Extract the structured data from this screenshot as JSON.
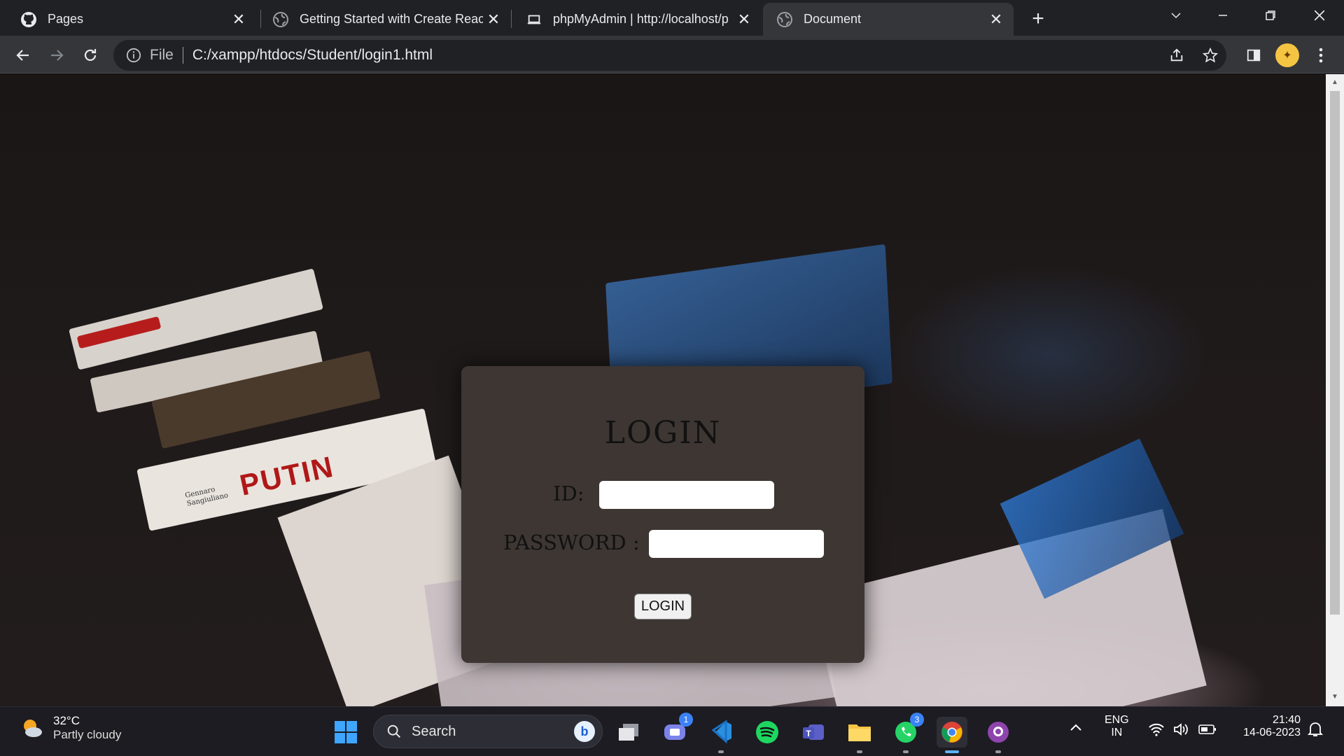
{
  "browser": {
    "tabs": [
      {
        "title": "Pages",
        "icon": "github-icon",
        "active": false
      },
      {
        "title": "Getting Started with Create React",
        "icon": "globe-icon",
        "active": false
      },
      {
        "title": "phpMyAdmin | http://localhost/p",
        "icon": "laptop-icon",
        "active": false
      },
      {
        "title": "Document",
        "icon": "globe-icon",
        "active": true
      }
    ],
    "address": {
      "scheme_label": "File",
      "url": "C:/xampp/htdocs/Student/login1.html"
    }
  },
  "login": {
    "heading": "LOGIN",
    "id_label": "ID:",
    "id_value": "",
    "password_label": "PASSWORD :",
    "password_value": "",
    "button_label": "LOGIN"
  },
  "background_text": {
    "book_title": "PUTIN",
    "book_author": "Gennaro Sangiuliano"
  },
  "taskbar": {
    "weather_temp": "32°C",
    "weather_desc": "Partly cloudy",
    "search_placeholder": "Search",
    "teams_badge": "1",
    "whatsapp_badge": "3",
    "language": "ENG",
    "region": "IN",
    "time": "21:40",
    "date": "14-06-2023"
  },
  "colors": {
    "card_bg": "#3d3632",
    "chrome_dark": "#202124",
    "chrome_toolbar": "#35363a",
    "taskbar_bg": "#1c1c22"
  }
}
